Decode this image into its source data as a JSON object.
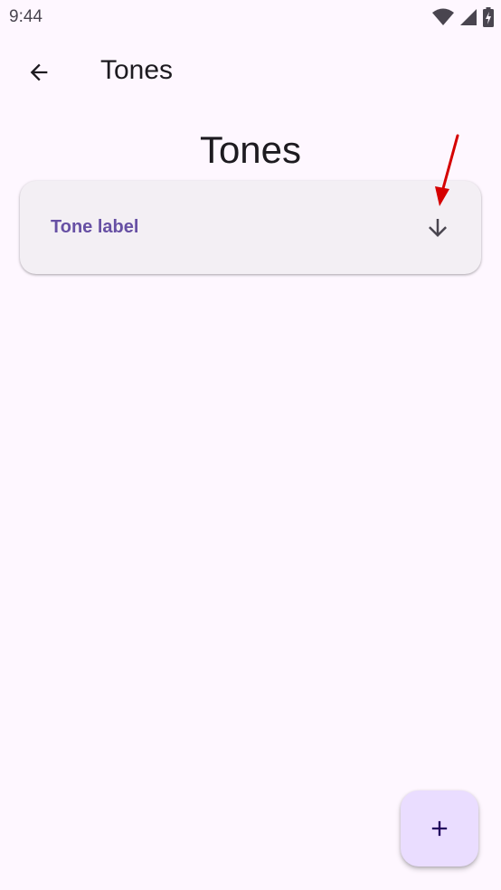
{
  "status_bar": {
    "time": "9:44",
    "icons": [
      "wifi-icon",
      "signal-icon",
      "battery-charging-icon"
    ]
  },
  "app_bar": {
    "back_icon": "arrow-back-icon",
    "title": "Tones"
  },
  "main": {
    "heading": "Tones",
    "tones": [
      {
        "label": "Tone label",
        "action_icon": "arrow-downward-icon"
      }
    ]
  },
  "fab": {
    "icon": "add-icon"
  },
  "colors": {
    "background": "#FEF7FF",
    "card": "#F3EFF4",
    "primary": "#6750A4",
    "fab_container": "#EADDFF",
    "on_surface": "#1D1B20",
    "annotation": "#D50000"
  }
}
